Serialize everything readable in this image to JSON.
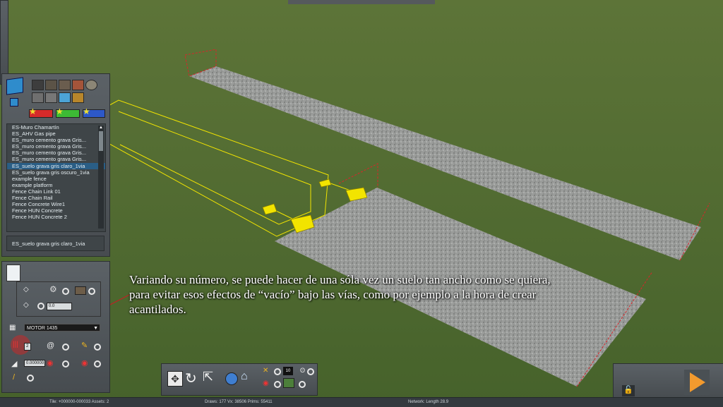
{
  "caption": "Variando su número, se puede hacer de una sóla vez un suelo tan ancho como se quiera, para evitar esos efectos de “vacío” bajo las vías, como por ejemplo a la hora de crear acantilados.",
  "asset_list": {
    "items": [
      "ES-Muro Chamartín",
      "ES_AHV Gas pipe",
      "ES_muro cemento grava Gris...",
      "ES_muro cemento grava Gris...",
      "ES_muro cemento grava Gris...",
      "ES_muro cemento grava Gris...",
      "ES_suelo grava gris claro_1via",
      "ES_suelo grava gris oscuro_1via",
      "example fence",
      "example platform",
      "Fence Chain Link 01",
      "Fence Chain Rail",
      "Fence Concrete Wire1",
      "Fence HUN Concrete",
      "Fence HUN Concrete 2"
    ],
    "selected_index": 6,
    "selected_name": "ES_suelo grava gris claro_1via"
  },
  "properties": {
    "field_a": "0.0",
    "track_type": "MOTOR 1435",
    "count": "2",
    "grade": "0.000000"
  },
  "bottom_toolbar": {
    "number_field": "10"
  },
  "status": {
    "tile": "Tile: +000000-000033  Assets: 2",
    "draws": "Draws: 177  Vx: 38506  Prims: 55411",
    "network": "Network:  Length   28.9"
  },
  "colors": {
    "grass": "#4f6a2e",
    "panel": "#50565b",
    "selection": "#2a5e86",
    "gizmo_yellow": "#f2e400",
    "marker_red": "#d8262a"
  }
}
